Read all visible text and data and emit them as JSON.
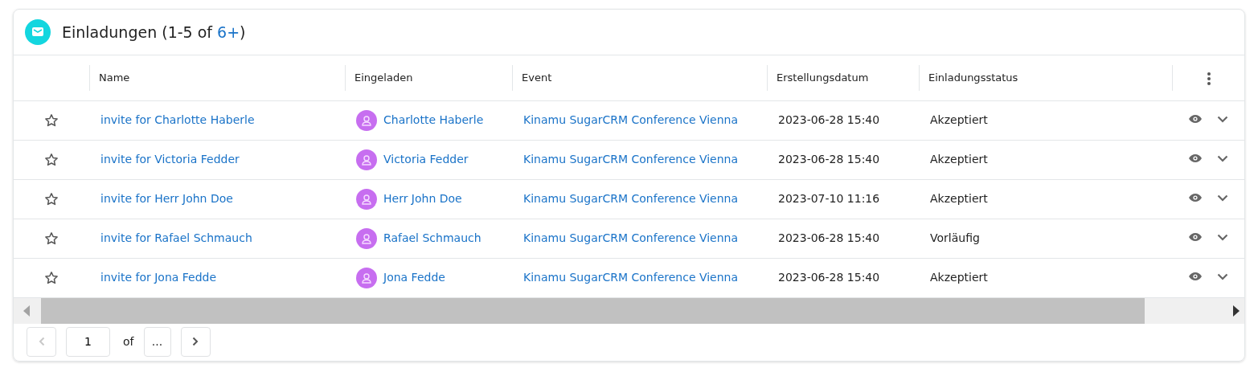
{
  "panel": {
    "title": "Einladungen",
    "count_prefix": "(1-5 of ",
    "count_link": "6+",
    "count_suffix": ")"
  },
  "table": {
    "columns": [
      "Name",
      "Eingeladen",
      "Event",
      "Erstellungsdatum",
      "Einladungsstatus"
    ],
    "rows": [
      {
        "favorite": false,
        "name": "invite for Charlotte Haberle",
        "invitee": "Charlotte Haberle",
        "event": "Kinamu SugarCRM Conference Vienna",
        "created": "2023-06-28 15:40",
        "status": "Akzeptiert"
      },
      {
        "favorite": false,
        "name": "invite for Victoria Fedder",
        "invitee": "Victoria Fedder",
        "event": "Kinamu SugarCRM Conference Vienna",
        "created": "2023-06-28 15:40",
        "status": "Akzeptiert"
      },
      {
        "favorite": false,
        "name": "invite for Herr John Doe",
        "invitee": "Herr John Doe",
        "event": "Kinamu SugarCRM Conference Vienna",
        "created": "2023-07-10 11:16",
        "status": "Akzeptiert"
      },
      {
        "favorite": false,
        "name": "invite for Rafael Schmauch",
        "invitee": "Rafael Schmauch",
        "event": "Kinamu SugarCRM Conference Vienna",
        "created": "2023-06-28 15:40",
        "status": "Vorläufig"
      },
      {
        "favorite": false,
        "name": "invite for Jona Fedde",
        "invitee": "Jona Fedde",
        "event": "Kinamu SugarCRM Conference Vienna",
        "created": "2023-06-28 15:40",
        "status": "Akzeptiert"
      }
    ]
  },
  "pagination": {
    "prev_disabled": true,
    "page": "1",
    "of_label": "of",
    "total": "...",
    "next_disabled": false
  }
}
